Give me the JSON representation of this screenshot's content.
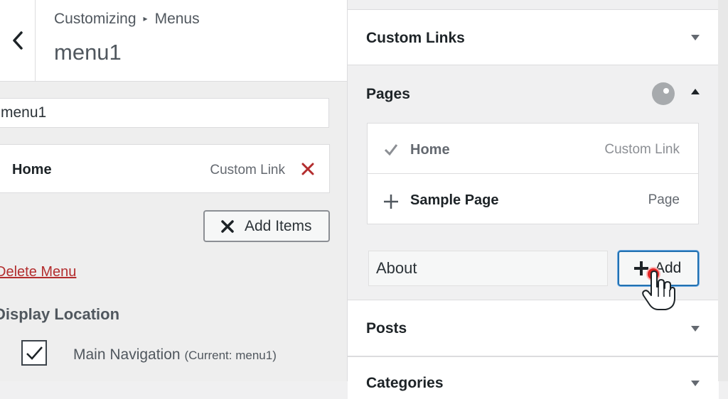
{
  "header": {
    "breadcrumb_root": "Customizing",
    "breadcrumb_separator": "▸",
    "breadcrumb_section": "Menus",
    "title": "menu1"
  },
  "menu_editor": {
    "menu_name_value": "menu1",
    "items": [
      {
        "title": "Home",
        "type": "Custom Link"
      }
    ],
    "add_items_label": "Add Items",
    "delete_menu_label": "Delete Menu",
    "display_location_heading": "Display Location",
    "locations": [
      {
        "label": "Main Navigation",
        "note": "(Current: menu1)",
        "checked": true
      }
    ]
  },
  "add_panel": {
    "sections": [
      {
        "label": "Custom Links",
        "expanded": false
      },
      {
        "label": "Pages",
        "expanded": true
      },
      {
        "label": "Posts",
        "expanded": false
      },
      {
        "label": "Categories",
        "expanded": false
      }
    ],
    "pages": [
      {
        "title": "Home",
        "type": "Custom Link",
        "added": true
      },
      {
        "title": "Sample Page",
        "type": "Page",
        "added": false
      }
    ],
    "new_page_value": "About",
    "add_button_label": "Add"
  },
  "icons": {
    "back": "chevron-left-icon",
    "remove": "close-icon",
    "check": "checkmark-icon",
    "plus": "plus-icon",
    "collapse": "triangle-down-icon",
    "expand": "triangle-up-icon",
    "loading": "spinner-icon",
    "cursor": "hand-pointer-icon"
  },
  "colors": {
    "accent": "#2271b1",
    "danger": "#b32d2e",
    "text": "#1d2327",
    "muted": "#646970"
  }
}
